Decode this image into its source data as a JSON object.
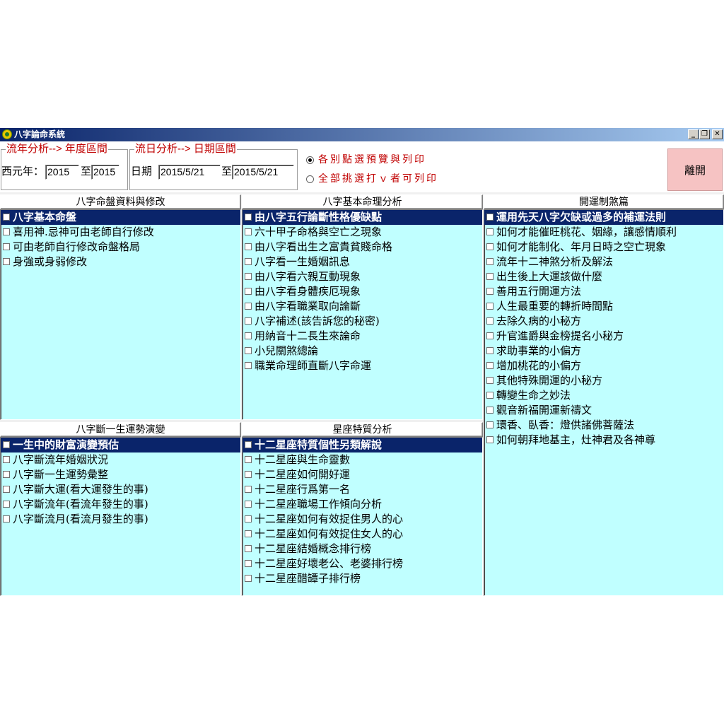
{
  "window": {
    "title": "八字論命系統",
    "buttons": {
      "minimize": "_",
      "restore": "❐",
      "close": "✕"
    }
  },
  "year_group": {
    "legend": "流年分析--> 年度區間",
    "label": "西元年：",
    "from": "2015",
    "to_label": "至",
    "to": "2015"
  },
  "day_group": {
    "legend": "流日分析--> 日期區間",
    "label": "日期",
    "from": "2015/5/21",
    "to_label": "至",
    "to": "2015/5/21"
  },
  "print_options": [
    {
      "label": "各別點選預覽與列印",
      "selected": true
    },
    {
      "label": "全部挑選打ｖ者可列印",
      "selected": false
    }
  ],
  "exit_label": "離開",
  "panels": {
    "p1": {
      "title": "八字命盤資料與修改",
      "items": [
        "八字基本命盤",
        "喜用神.忌神可由老師自行修改",
        "可由老師自行修改命盤格局",
        "身強或身弱修改"
      ]
    },
    "p2": {
      "title": "八字基本命理分析",
      "items": [
        "由八字五行論斷性格優缺點",
        "六十甲子命格與空亡之現象",
        "由八字看出生之富貴貧賤命格",
        "八字看一生婚姻訊息",
        "由八字看六親互動現象",
        "由八字看身體疾厄現象",
        "由八字看職業取向論斷",
        "八字補述(該告訴您的秘密)",
        "用納音十二長生來論命",
        "小兒關煞總論",
        "職業命理師直斷八字命運"
      ]
    },
    "p3": {
      "title": "開運制煞篇",
      "items": [
        "運用先天八字欠缺或過多的補運法則",
        "如何才能催旺桃花、姻緣，讓感情順利",
        "如何才能制化、年月日時之空亡現象",
        "流年十二神煞分析及解法",
        "出生後上大運該做什麼",
        "善用五行開運方法",
        "人生最重要的轉折時間點",
        "去除久病的小秘方",
        "升官進爵與金榜提名小秘方",
        "求助事業的小偏方",
        "增加桃花的小偏方",
        "其他特殊開運的小秘方",
        "轉變生命之妙法",
        "觀音新福開運新禱文",
        "環香、臥香：燈供諸佛菩薩法",
        "如何朝拜地基主，灶神君及各神尊"
      ]
    },
    "p4": {
      "title": "八字斷一生運勢演變",
      "items": [
        "一生中的財富演變預估",
        "八字斷流年婚姻狀況",
        "八字斷一生運勢彙整",
        "八字斷大運(看大運發生的事)",
        "八字斷流年(看流年發生的事)",
        "八字斷流月(看流月發生的事)"
      ]
    },
    "p5": {
      "title": "星座特質分析",
      "items": [
        "十二星座特質個性另類解說",
        "十二星座與生命靈數",
        "十二星座如何開好運",
        "十二星座行爲第一名",
        "十二星座職場工作傾向分析",
        "十二星座如何有效捉住男人的心",
        "十二星座如何有效捉住女人的心",
        "十二星座結婚概念排行榜",
        "十二星座好壞老公、老婆排行榜",
        "十二星座醋罈子排行榜"
      ]
    }
  }
}
